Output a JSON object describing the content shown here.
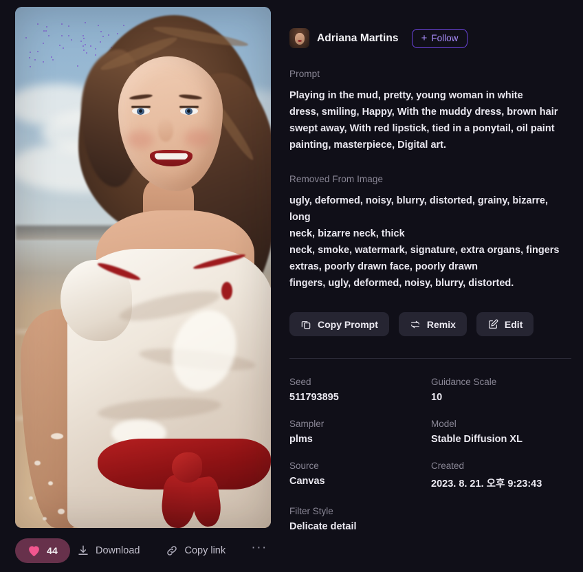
{
  "author": {
    "name": "Adriana Martins",
    "avatar_icon": "user-avatar-portrait",
    "follow_label": "Follow",
    "follow_plus": "+"
  },
  "prompt_section": {
    "label": "Prompt",
    "lines": [
      "Playing in the mud, pretty, young woman in white",
      "dress, smiling, Happy, With the muddy dress, brown hair",
      "swept away, With red lipstick, tied in a ponytail, oil paint",
      "painting, masterpiece, Digital art."
    ]
  },
  "negative_section": {
    "label": "Removed From Image",
    "lines": [
      "ugly, deformed, noisy, blurry, distorted, grainy, bizarre, long",
      "neck, bizarre neck, thick",
      "neck, smoke, watermark, signature, extra organs, fingers",
      "extras, poorly drawn face, poorly drawn",
      "fingers, ugly, deformed, noisy, blurry, distorted."
    ]
  },
  "actions": [
    {
      "label": "Copy Prompt",
      "icon": "copy-icon"
    },
    {
      "label": "Remix",
      "icon": "remix-icon"
    },
    {
      "label": "Edit",
      "icon": "edit-pencil-icon"
    }
  ],
  "metadata": [
    {
      "label": "Seed",
      "value": "511793895"
    },
    {
      "label": "Guidance Scale",
      "value": "10"
    },
    {
      "label": "Sampler",
      "value": "plms"
    },
    {
      "label": "Model",
      "value": "Stable Diffusion XL"
    },
    {
      "label": "Source",
      "value": "Canvas"
    },
    {
      "label": "Created",
      "value": "2023. 8. 21. 오후 9:23:43"
    },
    {
      "label": "Filter Style",
      "value": "Delicate detail"
    },
    {
      "label": "",
      "value": ""
    }
  ],
  "bottom_bar": {
    "like_count": "44",
    "like_icon": "heart-icon",
    "download_label": "Download",
    "download_icon": "download-icon",
    "copy_link_label": "Copy link",
    "copy_link_icon": "link-chain-icon",
    "more_label": "···",
    "more_icon": "ellipsis-icon"
  },
  "artwork": {
    "alt": "Digital oil painting of a smiling young woman with brown hair in a white dress with a red sash, standing on a muddy beach",
    "icon": "artwork-image"
  },
  "colors": {
    "background": "#100f18",
    "accent_purple": "#6d45e0",
    "like_pill": "#67314b",
    "heart_pink": "#f2568f",
    "chip_bg": "#262532"
  }
}
